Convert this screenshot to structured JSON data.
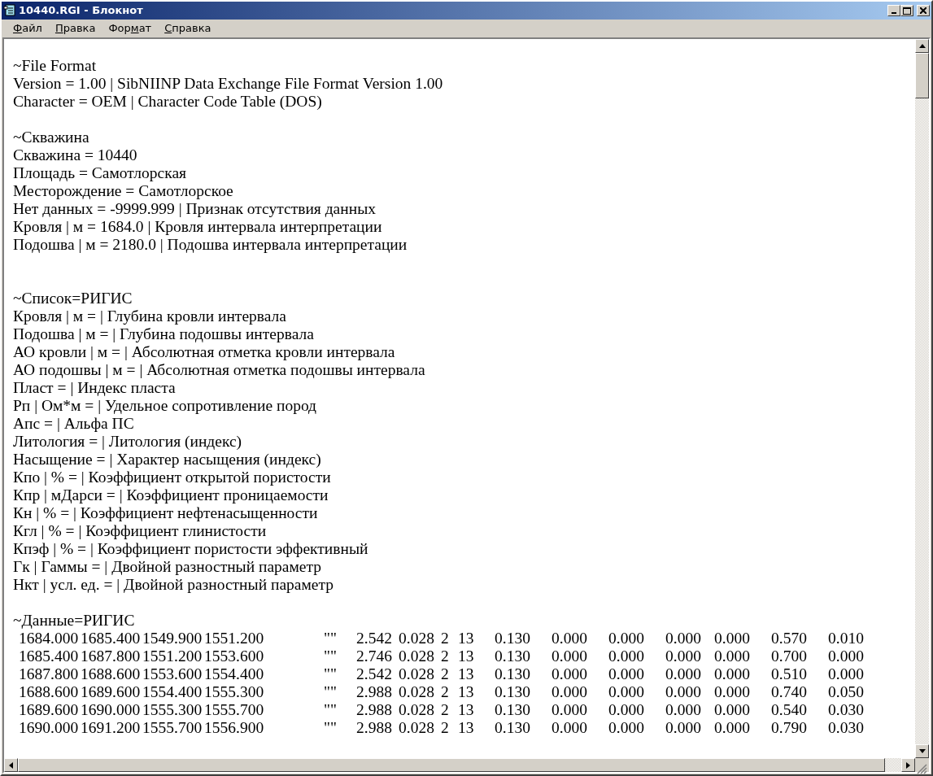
{
  "window": {
    "title": "10440.RGI - Блокнот"
  },
  "menu": [
    {
      "key": "Ф",
      "after": "айл"
    },
    {
      "key": "П",
      "after": "равка"
    },
    {
      "before": "Фор",
      "key": "м",
      "after": "ат"
    },
    {
      "key": "С",
      "after": "правка"
    }
  ],
  "lines": [
    {
      "kind": "blank"
    },
    {
      "kind": "text",
      "text": "~File Format"
    },
    {
      "kind": "text",
      "text": "Version = 1.00 | SibNIINP Data Exchange File Format Version 1.00"
    },
    {
      "kind": "text",
      "text": "Character = OEM | Character Code Table (DOS)"
    },
    {
      "kind": "blank"
    },
    {
      "kind": "text",
      "text": "~Скважина"
    },
    {
      "kind": "text",
      "text": "Скважина = 10440"
    },
    {
      "kind": "text",
      "text": "Площадь = Самотлорская"
    },
    {
      "kind": "text",
      "text": "Месторождение = Самотлорское"
    },
    {
      "kind": "text",
      "text": "Нет данных = -9999.999 | Признак отсутствия данных"
    },
    {
      "kind": "text",
      "text": "Кровля | м = 1684.0 | Кровля интервала интерпретации"
    },
    {
      "kind": "text",
      "text": "Подошва | м = 2180.0 | Подошва интервала интерпретации"
    },
    {
      "kind": "blank"
    },
    {
      "kind": "blank"
    },
    {
      "kind": "text",
      "text": "~Список=РИГИС"
    },
    {
      "kind": "text",
      "text": "Кровля | м = | Глубина кровли интервала"
    },
    {
      "kind": "text",
      "text": "Подошва | м = | Глубина подошвы интервала"
    },
    {
      "kind": "text",
      "text": "АО кровли | м = | Абсолютная отметка кровли интервала"
    },
    {
      "kind": "text",
      "text": "АО подошвы | м = | Абсолютная отметка подошвы интервала"
    },
    {
      "kind": "text",
      "text": "Пласт = | Индекс пласта"
    },
    {
      "kind": "text",
      "text": "Рп | Ом*м = | Удельное сопротивление пород"
    },
    {
      "kind": "text",
      "text": "Апс = | Альфа ПС"
    },
    {
      "kind": "text",
      "text": "Литология = | Литология (индекс)"
    },
    {
      "kind": "text",
      "text": "Насыщение = | Характер насыщения (индекс)"
    },
    {
      "kind": "text",
      "text": "Кпо | % = | Коэффициент открытой пористости"
    },
    {
      "kind": "text",
      "text": "Кпр | мДарси = | Коэффициент проницаемости"
    },
    {
      "kind": "text",
      "text": "Кн | % = | Коэффициент нефтенасыщенности"
    },
    {
      "kind": "text",
      "text": "Кгл | % = | Коэффициент глинистости"
    },
    {
      "kind": "text",
      "text": "Кпэф | % = | Коэффициент пористости эффективный"
    },
    {
      "kind": "text",
      "text": "Гк | Гаммы = | Двойной разностный параметр"
    },
    {
      "kind": "text",
      "text": "Нкт | усл. ед. = | Двойной разностный параметр"
    },
    {
      "kind": "blank"
    },
    {
      "kind": "text",
      "text": "~Данные=РИГИС"
    }
  ],
  "data_rows": [
    [
      "1684.000",
      "1685.400",
      "1549.900",
      "1551.200",
      "\"\"",
      "2.542",
      "0.028",
      "2",
      "13",
      "0.130",
      "0.000",
      "0.000",
      "0.000",
      "0.000",
      "0.570",
      "0.010"
    ],
    [
      "1685.400",
      "1687.800",
      "1551.200",
      "1553.600",
      "\"\"",
      "2.746",
      "0.028",
      "2",
      "13",
      "0.130",
      "0.000",
      "0.000",
      "0.000",
      "0.000",
      "0.700",
      "0.000"
    ],
    [
      "1687.800",
      "1688.600",
      "1553.600",
      "1554.400",
      "\"\"",
      "2.542",
      "0.028",
      "2",
      "13",
      "0.130",
      "0.000",
      "0.000",
      "0.000",
      "0.000",
      "0.510",
      "0.000"
    ],
    [
      "1688.600",
      "1689.600",
      "1554.400",
      "1555.300",
      "\"\"",
      "2.988",
      "0.028",
      "2",
      "13",
      "0.130",
      "0.000",
      "0.000",
      "0.000",
      "0.000",
      "0.740",
      "0.050"
    ],
    [
      "1689.600",
      "1690.000",
      "1555.300",
      "1555.700",
      "\"\"",
      "2.988",
      "0.028",
      "2",
      "13",
      "0.130",
      "0.000",
      "0.000",
      "0.000",
      "0.000",
      "0.540",
      "0.030"
    ],
    [
      "1690.000",
      "1691.200",
      "1555.700",
      "1556.900",
      "\"\"",
      "2.988",
      "0.028",
      "2",
      "13",
      "0.130",
      "0.000",
      "0.000",
      "0.000",
      "0.000",
      "0.790",
      "0.030"
    ]
  ]
}
